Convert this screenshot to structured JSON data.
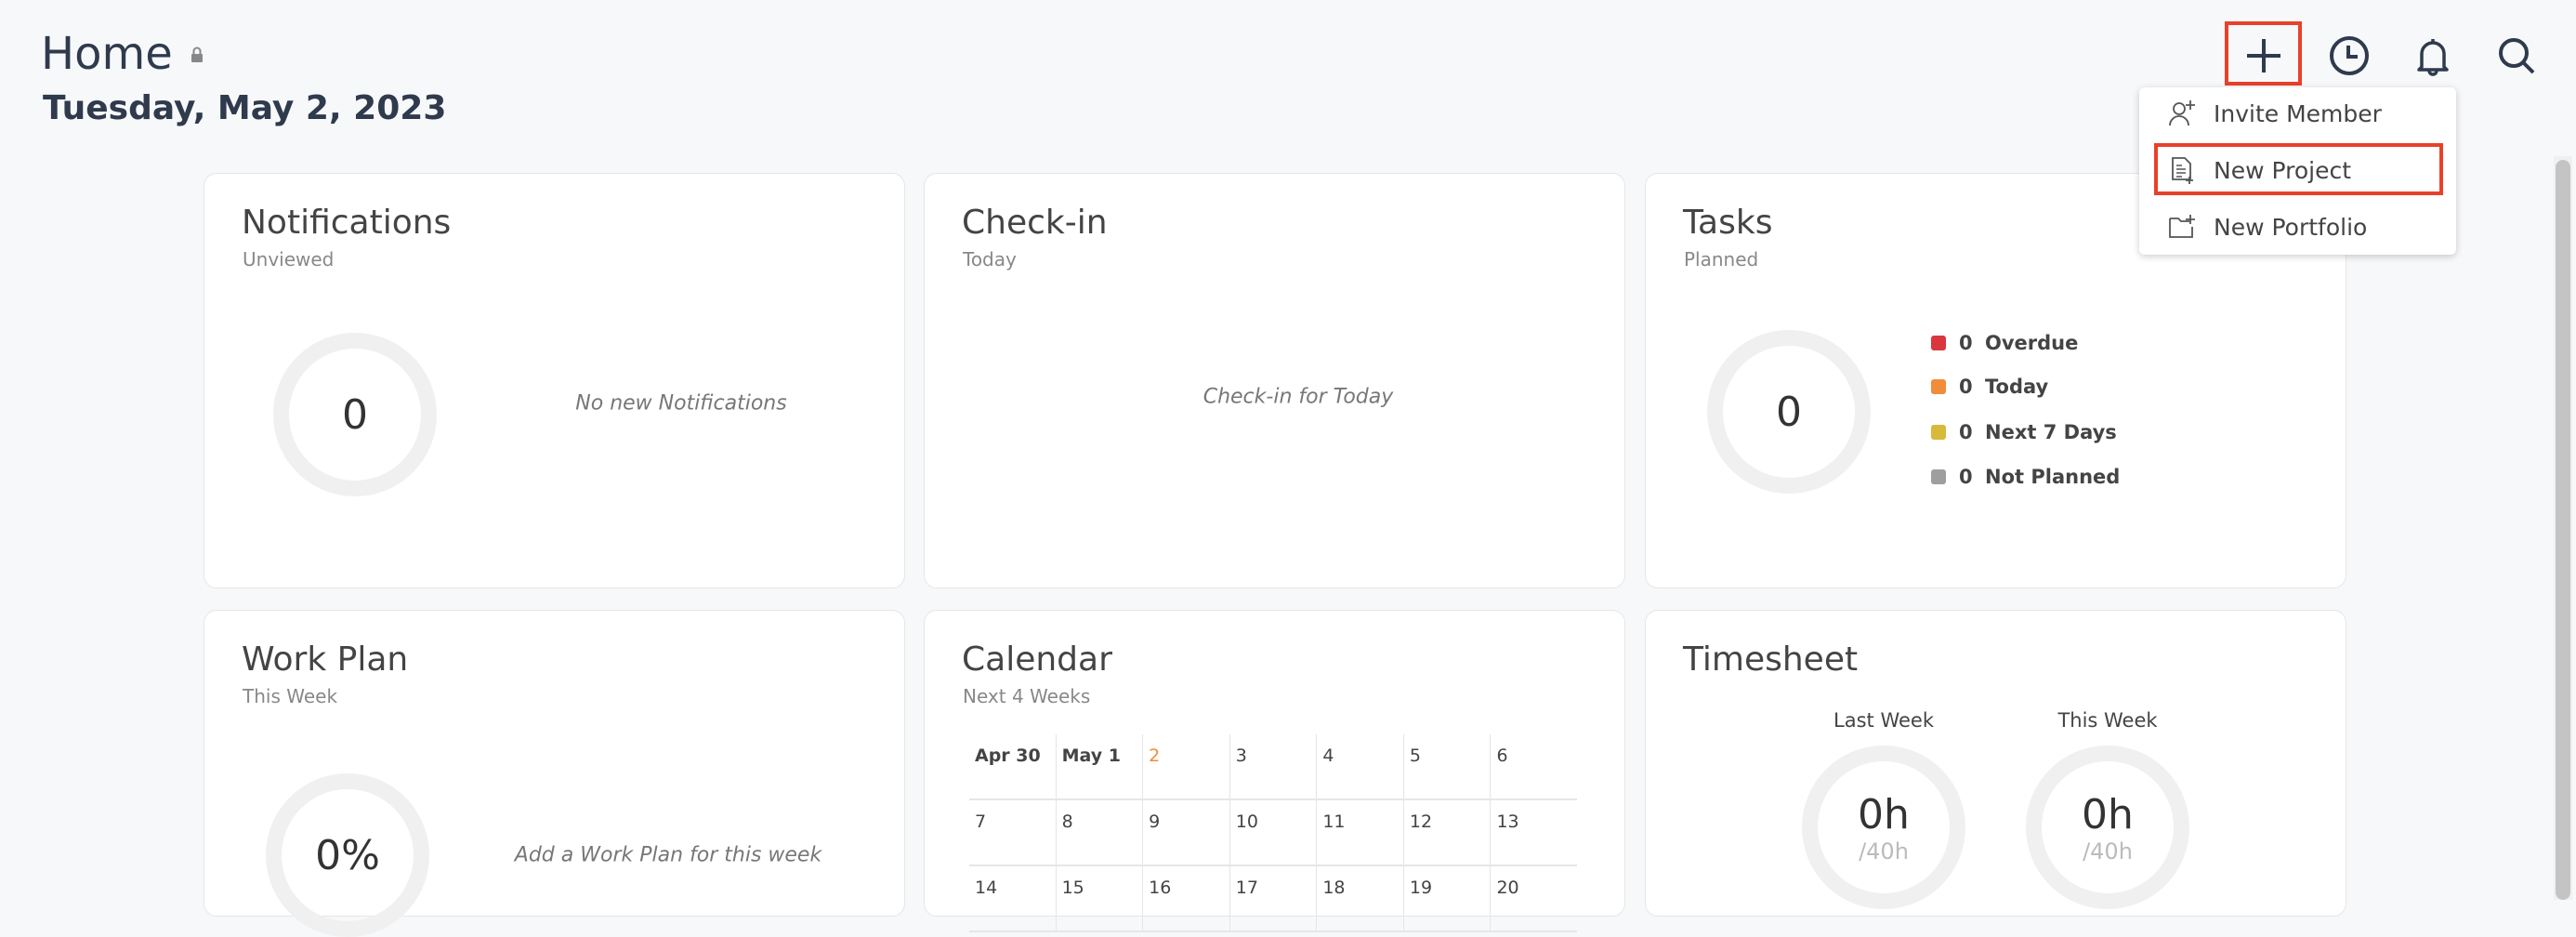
{
  "header": {
    "title": "Home",
    "date": "Tuesday, May 2, 2023"
  },
  "toolbar": {
    "icons": [
      "plus-icon",
      "clock-icon",
      "bell-icon",
      "search-icon"
    ]
  },
  "add_menu": {
    "items": [
      {
        "label": "Invite Member",
        "icon": "add-user-icon"
      },
      {
        "label": "New Project",
        "icon": "new-document-icon"
      },
      {
        "label": "New Portfolio",
        "icon": "new-folder-icon"
      }
    ]
  },
  "notifications": {
    "title": "Notifications",
    "subtitle": "Unviewed",
    "count": "0",
    "empty": "No new Notifications"
  },
  "checkin": {
    "title": "Check-in",
    "subtitle": "Today",
    "empty": "Check-in for Today"
  },
  "tasks": {
    "title": "Tasks",
    "subtitle": "Planned",
    "count": "0",
    "legend": [
      {
        "count": "0",
        "label": "Overdue",
        "color": "#d9363e"
      },
      {
        "count": "0",
        "label": "Today",
        "color": "#f08c3a"
      },
      {
        "count": "0",
        "label": "Next 7 Days",
        "color": "#d8b93a"
      },
      {
        "count": "0",
        "label": "Not Planned",
        "color": "#9e9e9e"
      }
    ]
  },
  "workplan": {
    "title": "Work Plan",
    "subtitle": "This Week",
    "percent": "0%",
    "empty": "Add a Work Plan for this week"
  },
  "calendar": {
    "title": "Calendar",
    "subtitle": "Next 4 Weeks",
    "today": "2",
    "today_color": "#f08c3a",
    "weeks": [
      [
        "Apr 30",
        "May 1",
        "2",
        "3",
        "4",
        "5",
        "6"
      ],
      [
        "7",
        "8",
        "9",
        "10",
        "11",
        "12",
        "13"
      ],
      [
        "14",
        "15",
        "16",
        "17",
        "18",
        "19",
        "20"
      ]
    ]
  },
  "timesheet": {
    "title": "Timesheet",
    "last_week": {
      "label": "Last Week",
      "hours": "0h",
      "target": "/40h"
    },
    "this_week": {
      "label": "This Week",
      "hours": "0h",
      "target": "/40h"
    }
  }
}
